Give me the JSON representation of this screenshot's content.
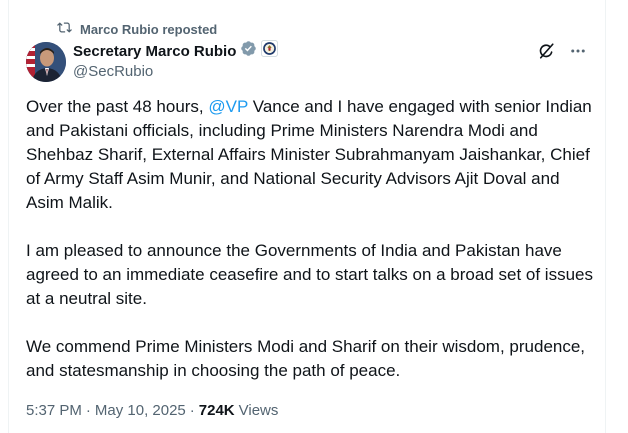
{
  "repost": {
    "label": "Marco Rubio reposted",
    "icon": "repost-icon"
  },
  "author": {
    "name": "Secretary Marco Rubio",
    "handle": "@SecRubio",
    "verified_icon": "verified-gray-badge-icon",
    "affiliation_icon": "us-seal-icon"
  },
  "actions": {
    "grok_icon": "grok-icon",
    "more_icon": "more-icon"
  },
  "post": {
    "p1_before": "Over the past 48 hours, ",
    "p1_mention": "@VP",
    "p1_after": " Vance and I have engaged with senior Indian and Pakistani officials, including Prime Ministers Narendra Modi and Shehbaz Sharif, External Affairs Minister Subrahmanyam Jaishankar, Chief of Army Staff Asim Munir, and National Security Advisors Ajit Doval and Asim Malik.",
    "p2": "I am pleased to announce the Governments of India and Pakistan have agreed to an immediate ceasefire and to start talks on a broad set of issues at a neutral site.",
    "p3": "We commend Prime Ministers Modi and Sharif on their wisdom, prudence, and statesmanship in choosing the path of peace."
  },
  "meta": {
    "time": "5:37 PM",
    "separator": "·",
    "date": "May 10, 2025",
    "views_count": "724K",
    "views_label": "Views"
  },
  "colors": {
    "accent": "#1d9bf0",
    "muted": "#536471",
    "text": "#0f1419",
    "border": "#eff3f4"
  }
}
